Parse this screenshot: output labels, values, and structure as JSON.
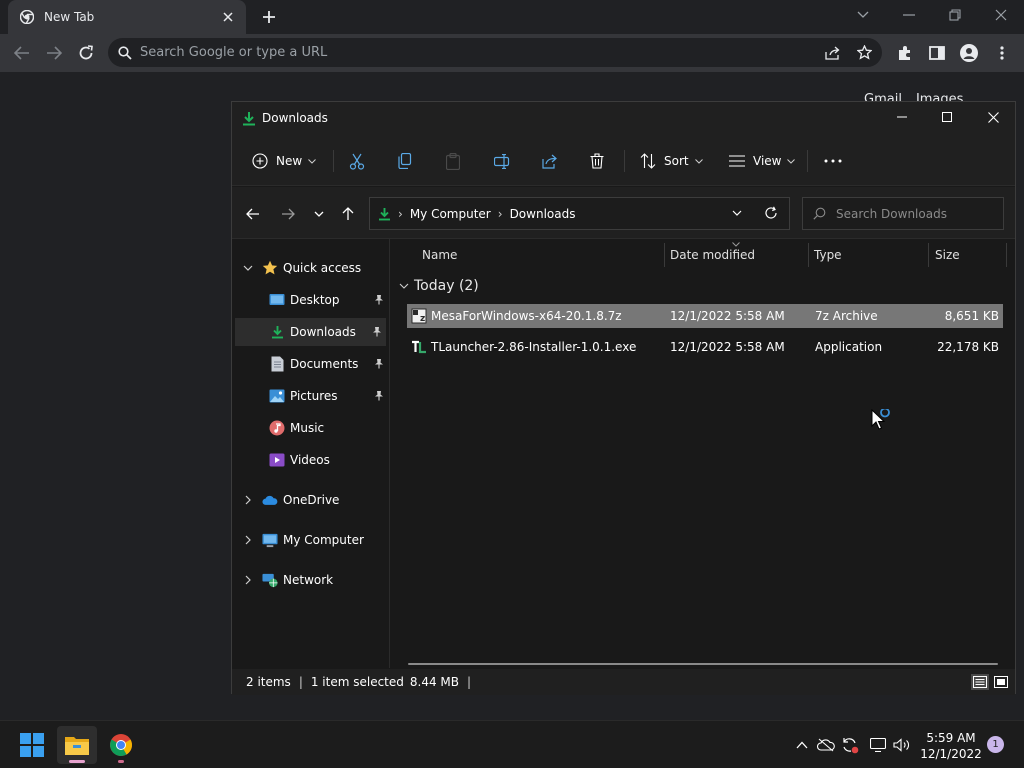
{
  "browser": {
    "tab_title": "New Tab",
    "omnibox_placeholder": "Search Google or type a URL",
    "links": [
      "Gmail",
      "Images"
    ]
  },
  "explorer": {
    "title": "Downloads",
    "commands": {
      "new": "New",
      "sort": "Sort",
      "view": "View"
    },
    "breadcrumb": [
      "My Computer",
      "Downloads"
    ],
    "search_placeholder": "Search Downloads",
    "nav": {
      "quick_access": "Quick access",
      "items": [
        {
          "label": "Desktop",
          "pinned": true
        },
        {
          "label": "Downloads",
          "pinned": true,
          "selected": true
        },
        {
          "label": "Documents",
          "pinned": true
        },
        {
          "label": "Pictures",
          "pinned": true
        },
        {
          "label": "Music",
          "pinned": false
        },
        {
          "label": "Videos",
          "pinned": false
        }
      ],
      "roots": [
        "OneDrive",
        "My Computer",
        "Network"
      ]
    },
    "columns": {
      "name": "Name",
      "date": "Date modified",
      "type": "Type",
      "size": "Size"
    },
    "group": "Today (2)",
    "files": [
      {
        "name": "MesaForWindows-x64-20.1.8.7z",
        "date": "12/1/2022 5:58 AM",
        "type": "7z Archive",
        "size": "8,651 KB",
        "selected": true
      },
      {
        "name": "TLauncher-2.86-Installer-1.0.1.exe",
        "date": "12/1/2022 5:58 AM",
        "type": "Application",
        "size": "22,178 KB",
        "selected": false
      }
    ],
    "status": {
      "count": "2 items",
      "selection": "1 item selected",
      "size": "8.44 MB"
    }
  },
  "taskbar": {
    "time": "5:59 AM",
    "date": "12/1/2022",
    "notifications": "1"
  },
  "colors": {
    "accent": "#1fb25a",
    "selected_row": "#777777",
    "folder_yellow": "#f2c14e"
  }
}
